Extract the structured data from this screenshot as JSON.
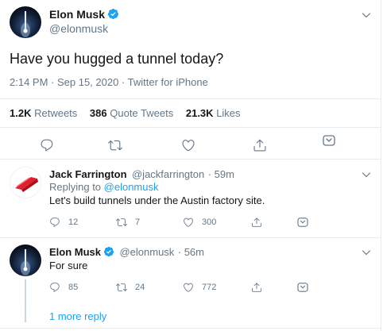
{
  "main_tweet": {
    "author_name": "Elon Musk",
    "author_handle": "@elonmusk",
    "text": "Have you hugged a tunnel today?",
    "timestamp": "2:14 PM · Sep 15, 2020 · ",
    "source": "Twitter for iPhone",
    "stats": {
      "retweets_count": "1.2K",
      "retweets_label": "Retweets",
      "quote_count": "386",
      "quote_label": "Quote Tweets",
      "likes_count": "21.3K",
      "likes_label": "Likes"
    }
  },
  "replies": [
    {
      "author_name": "Jack Farrington",
      "author_handle": "@jackfarrington",
      "time": "· 59m",
      "replying_prefix": "Replying to ",
      "replying_handle": "@elonmusk",
      "text": "Let's build tunnels under the Austin factory site.",
      "reply_count": "12",
      "retweet_count": "7",
      "like_count": "300"
    },
    {
      "author_name": "Elon Musk",
      "author_handle": "@elonmusk",
      "time": "· 56m",
      "text": "For sure",
      "reply_count": "85",
      "retweet_count": "24",
      "like_count": "772"
    }
  ],
  "more_replies": "1 more reply",
  "colors": {
    "accent": "#1da1f2",
    "secondary_text": "#657786",
    "border": "#e6ecf0"
  },
  "icons": [
    "verified-badge-icon",
    "chevron-down-icon",
    "reply-icon",
    "retweet-icon",
    "like-icon",
    "share-icon",
    "tip-icon",
    "more-dots-icon"
  ]
}
